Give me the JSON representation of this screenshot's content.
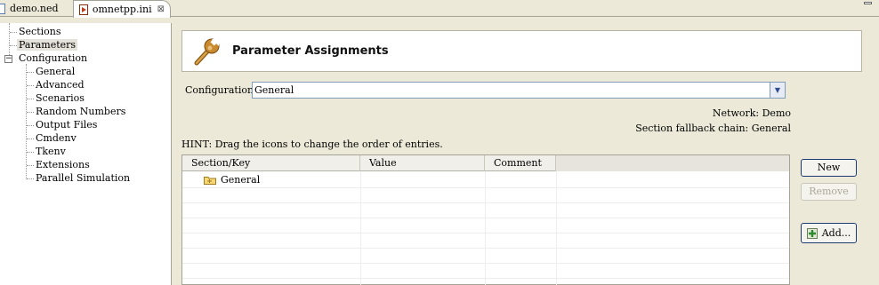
{
  "tabs": [
    {
      "label": "demo.ned",
      "active": false
    },
    {
      "label": "omnetpp.ini",
      "active": true,
      "close": "⊠"
    }
  ],
  "tree": {
    "items": [
      {
        "label": "Sections"
      },
      {
        "label": "Parameters"
      },
      {
        "label": "Configuration",
        "expander": "−"
      },
      {
        "label": "General"
      },
      {
        "label": "Advanced"
      },
      {
        "label": "Scenarios"
      },
      {
        "label": "Random Numbers"
      },
      {
        "label": "Output Files"
      },
      {
        "label": "Cmdenv"
      },
      {
        "label": "Tkenv"
      },
      {
        "label": "Extensions"
      },
      {
        "label": "Parallel Simulation"
      }
    ]
  },
  "page": {
    "title": "Parameter Assignments",
    "config_label": "Configuration:",
    "config_value": "General",
    "network": "Network: Demo",
    "fallback": "Section fallback chain: General",
    "hint": "HINT: Drag the icons to change the order of entries."
  },
  "table": {
    "columns": [
      "Section/Key",
      "Value",
      "Comment"
    ],
    "rows": [
      {
        "label": "General",
        "icon": "folder-icon"
      }
    ]
  },
  "buttons": {
    "new": "New",
    "remove": "Remove",
    "add": "Add..."
  },
  "colors": {
    "background": "#ece9d8",
    "button_border": "#1c3a71",
    "disabled_text": "#aca899"
  }
}
